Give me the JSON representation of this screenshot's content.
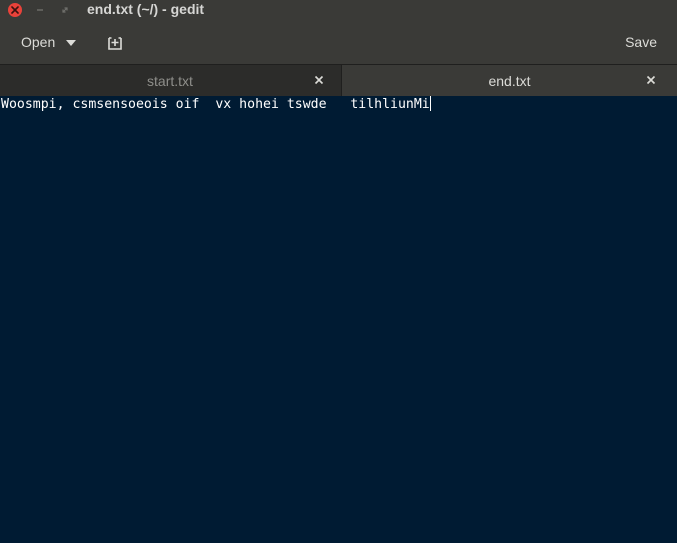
{
  "window": {
    "title": "end.txt (~/) - gedit"
  },
  "headerbar": {
    "open_label": "Open",
    "save_label": "Save"
  },
  "tabs": [
    {
      "label": "start.txt",
      "active": false
    },
    {
      "label": "end.txt",
      "active": true
    }
  ],
  "editor": {
    "text": "Woosmpi, csmsensoeois oif  vx hohei tswde   tilhliunMi"
  },
  "icons": {
    "close": "close-icon",
    "minimize": "minimize-icon",
    "maximize": "maximize-icon",
    "new_document": "new-document-icon",
    "dropdown": "chevron-down-icon",
    "tab_close": "close-icon"
  },
  "colors": {
    "titlebar_bg": "#3a3a37",
    "tabbar_bg": "#2c2c2a",
    "editor_bg": "#001b33",
    "close_button": "#e9423a",
    "text_light": "#dcdcd8",
    "text_dim": "#8e8e8a"
  }
}
